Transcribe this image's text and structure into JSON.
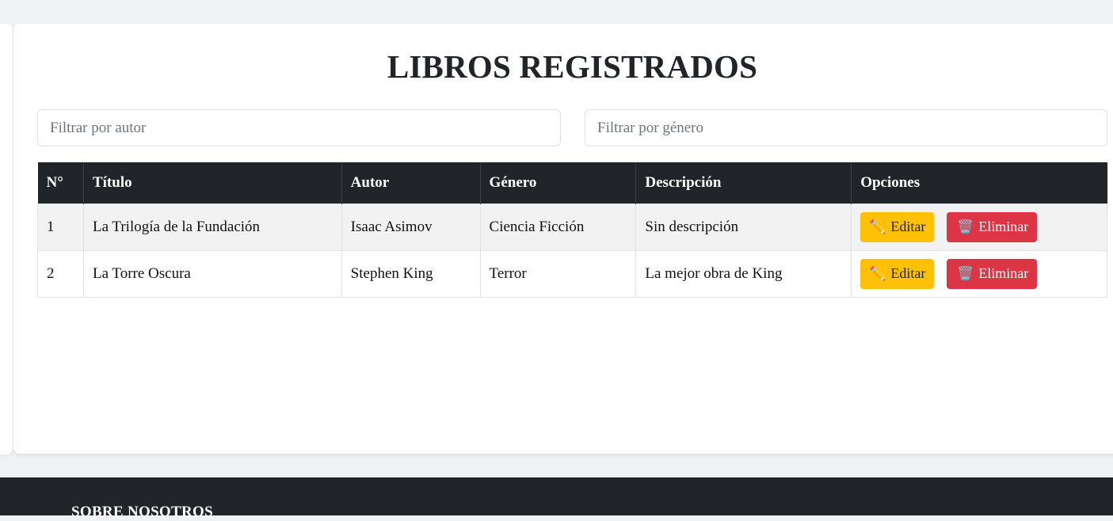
{
  "page": {
    "title": "LIBROS REGISTRADOS"
  },
  "filters": {
    "autor_placeholder": "Filtrar por autor",
    "genero_placeholder": "Filtrar por género"
  },
  "table": {
    "headers": [
      "N°",
      "Título",
      "Autor",
      "Género",
      "Descripción",
      "Opciones"
    ],
    "rows": [
      {
        "n": "1",
        "titulo": "La Trilogía de la Fundación",
        "autor": "Isaac Asimov",
        "genero": "Ciencia Ficción",
        "descripcion": "Sin descripción"
      },
      {
        "n": "2",
        "titulo": "La Torre Oscura",
        "autor": "Stephen King",
        "genero": "Terror",
        "descripcion": "La mejor obra de King"
      }
    ],
    "actions": {
      "edit_label": "Editar",
      "delete_label": "Eliminar",
      "edit_icon": "pencil-icon",
      "delete_icon": "wastebasket-icon"
    }
  },
  "footer": {
    "section_title": "SOBRE NOSOTROS"
  },
  "colors": {
    "header_bg": "#212529",
    "edit_button": "#ffc107",
    "delete_button": "#dc3545"
  }
}
